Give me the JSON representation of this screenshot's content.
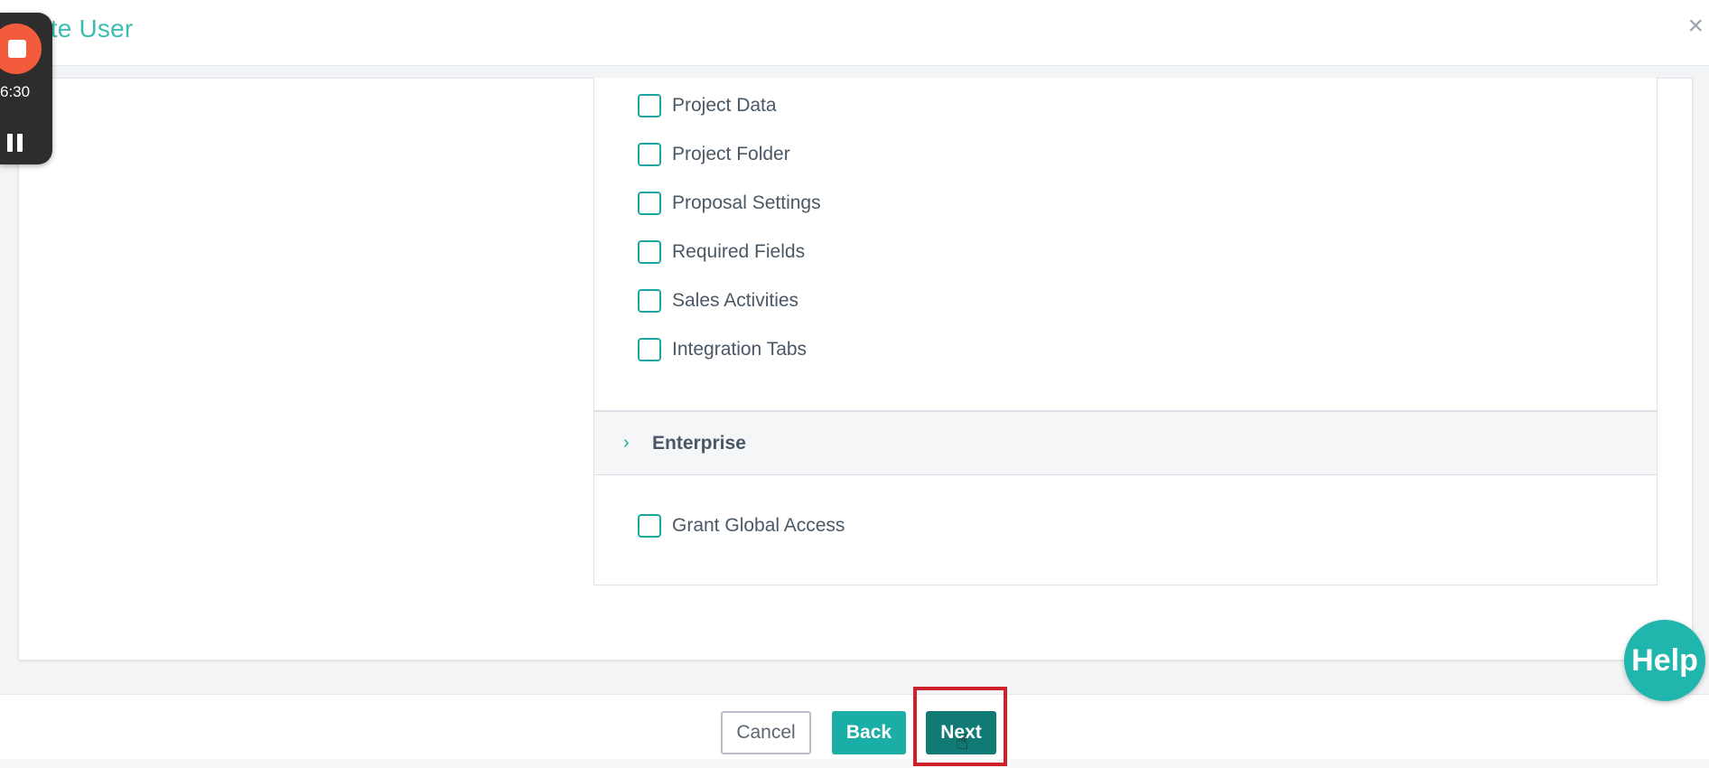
{
  "header": {
    "title": "ate User",
    "close_glyph": "×"
  },
  "recorder": {
    "time": "6:30",
    "stop_icon": "stop-icon",
    "pause_icon": "pause-icon"
  },
  "permissions": {
    "items": [
      {
        "label": "Project Data",
        "checked": false
      },
      {
        "label": "Project Folder",
        "checked": false
      },
      {
        "label": "Proposal Settings",
        "checked": false
      },
      {
        "label": "Required Fields",
        "checked": false
      },
      {
        "label": "Sales Activities",
        "checked": false
      },
      {
        "label": "Integration Tabs",
        "checked": false
      }
    ],
    "section": {
      "title": "Enterprise",
      "chevron": "›"
    },
    "global_access": {
      "label": "Grant Global Access",
      "checked": false
    }
  },
  "footer": {
    "cancel_label": "Cancel",
    "back_label": "Back",
    "next_label": "Next"
  },
  "help": {
    "label": "Help"
  },
  "colors": {
    "accent": "#1aa9a1",
    "next_button": "#117a74",
    "highlight": "#d0202b",
    "recorder_stop": "#f25b3b"
  }
}
